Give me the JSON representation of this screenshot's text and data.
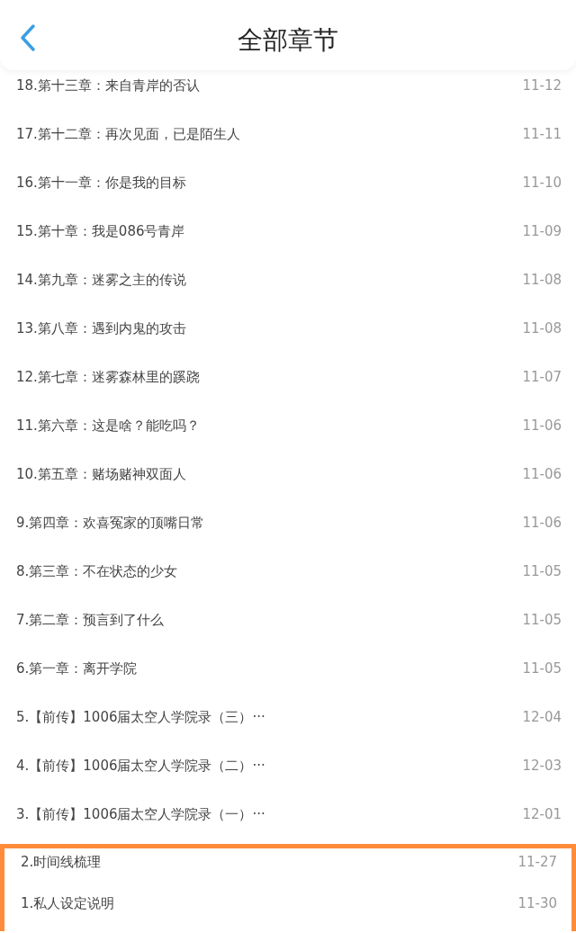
{
  "header": {
    "title": "全部章节"
  },
  "chapters": [
    {
      "title": "18.第十三章：来自青岸的否认",
      "date": "11-12",
      "highlighted": false
    },
    {
      "title": "17.第十二章：再次见面，已是陌生人",
      "date": "11-11",
      "highlighted": false
    },
    {
      "title": "16.第十一章：你是我的目标",
      "date": "11-10",
      "highlighted": false
    },
    {
      "title": "15.第十章：我是086号青岸",
      "date": "11-09",
      "highlighted": false
    },
    {
      "title": "14.第九章：迷雾之主的传说",
      "date": "11-08",
      "highlighted": false
    },
    {
      "title": "13.第八章：遇到内鬼的攻击",
      "date": "11-08",
      "highlighted": false
    },
    {
      "title": "12.第七章：迷雾森林里的蹊跷",
      "date": "11-07",
      "highlighted": false
    },
    {
      "title": "11.第六章：这是啥？能吃吗？",
      "date": "11-06",
      "highlighted": false
    },
    {
      "title": "10.第五章：赌场赌神双面人",
      "date": "11-06",
      "highlighted": false
    },
    {
      "title": "9.第四章：欢喜冤家的顶嘴日常",
      "date": "11-06",
      "highlighted": false
    },
    {
      "title": "8.第三章：不在状态的少女",
      "date": "11-05",
      "highlighted": false
    },
    {
      "title": "7.第二章：预言到了什么",
      "date": "11-05",
      "highlighted": false
    },
    {
      "title": "6.第一章：离开学院",
      "date": "11-05",
      "highlighted": false
    },
    {
      "title": "5.【前传】1006届太空人学院录（三）···",
      "date": "12-04",
      "highlighted": false
    },
    {
      "title": "4.【前传】1006届太空人学院录（二）···",
      "date": "12-03",
      "highlighted": false
    },
    {
      "title": "3.【前传】1006届太空人学院录（一）···",
      "date": "12-01",
      "highlighted": false
    },
    {
      "title": "2.时间线梳理",
      "date": "11-27",
      "highlighted": true
    },
    {
      "title": "1.私人设定说明",
      "date": "11-30",
      "highlighted": true
    }
  ]
}
